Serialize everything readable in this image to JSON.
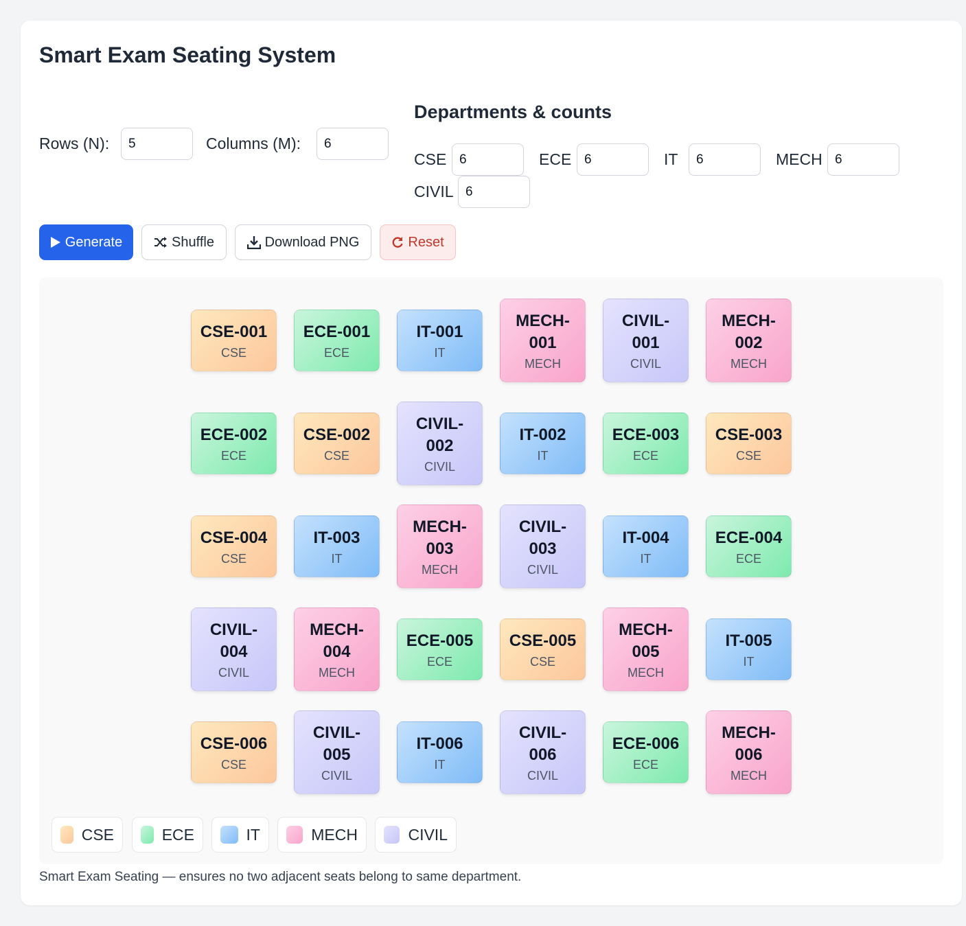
{
  "app": {
    "title": "Smart Exam Seating System"
  },
  "controls": {
    "rows_label": "Rows (N):",
    "rows_value": "5",
    "cols_label": "Columns (M):",
    "cols_value": "6"
  },
  "departments": {
    "title": "Departments & counts",
    "items": [
      {
        "label": "CSE",
        "value": "6"
      },
      {
        "label": "ECE",
        "value": "6"
      },
      {
        "label": "IT",
        "value": "6"
      },
      {
        "label": "MECH",
        "value": "6"
      },
      {
        "label": "CIVIL",
        "value": "6"
      }
    ]
  },
  "actions": {
    "generate": {
      "label": "Generate",
      "icon": "play-icon"
    },
    "shuffle": {
      "label": "Shuffle",
      "icon": "shuffle-icon"
    },
    "download": {
      "label": "Download PNG",
      "icon": "download-icon"
    },
    "reset": {
      "label": "Reset",
      "icon": "refresh-icon"
    }
  },
  "colors": {
    "CSE": [
      "#fee8bd",
      "#fdc79d"
    ],
    "ECE": [
      "#c9f5dc",
      "#7eeaae"
    ],
    "IT": [
      "#c4e1fd",
      "#80bcf7"
    ],
    "MECH": [
      "#fdd0e6",
      "#f9a4cb"
    ],
    "CIVIL": [
      "#e4e2fd",
      "#c7c7f9"
    ],
    "accent": "#2563eb"
  },
  "seating": {
    "rows": [
      [
        {
          "id": "CSE-001",
          "dept": "CSE"
        },
        {
          "id": "ECE-001",
          "dept": "ECE"
        },
        {
          "id": "IT-001",
          "dept": "IT"
        },
        {
          "id": "MECH-001",
          "dept": "MECH"
        },
        {
          "id": "CIVIL-001",
          "dept": "CIVIL"
        },
        {
          "id": "MECH-002",
          "dept": "MECH"
        }
      ],
      [
        {
          "id": "ECE-002",
          "dept": "ECE"
        },
        {
          "id": "CSE-002",
          "dept": "CSE"
        },
        {
          "id": "CIVIL-002",
          "dept": "CIVIL"
        },
        {
          "id": "IT-002",
          "dept": "IT"
        },
        {
          "id": "ECE-003",
          "dept": "ECE"
        },
        {
          "id": "CSE-003",
          "dept": "CSE"
        }
      ],
      [
        {
          "id": "CSE-004",
          "dept": "CSE"
        },
        {
          "id": "IT-003",
          "dept": "IT"
        },
        {
          "id": "MECH-003",
          "dept": "MECH"
        },
        {
          "id": "CIVIL-003",
          "dept": "CIVIL"
        },
        {
          "id": "IT-004",
          "dept": "IT"
        },
        {
          "id": "ECE-004",
          "dept": "ECE"
        }
      ],
      [
        {
          "id": "CIVIL-004",
          "dept": "CIVIL"
        },
        {
          "id": "MECH-004",
          "dept": "MECH"
        },
        {
          "id": "ECE-005",
          "dept": "ECE"
        },
        {
          "id": "CSE-005",
          "dept": "CSE"
        },
        {
          "id": "MECH-005",
          "dept": "MECH"
        },
        {
          "id": "IT-005",
          "dept": "IT"
        }
      ],
      [
        {
          "id": "CSE-006",
          "dept": "CSE"
        },
        {
          "id": "CIVIL-005",
          "dept": "CIVIL"
        },
        {
          "id": "IT-006",
          "dept": "IT"
        },
        {
          "id": "CIVIL-006",
          "dept": "CIVIL"
        },
        {
          "id": "ECE-006",
          "dept": "ECE"
        },
        {
          "id": "MECH-006",
          "dept": "MECH"
        }
      ]
    ]
  },
  "legend": [
    "CSE",
    "ECE",
    "IT",
    "MECH",
    "CIVIL"
  ],
  "footer": "Smart Exam Seating — ensures no two adjacent seats belong to same department."
}
